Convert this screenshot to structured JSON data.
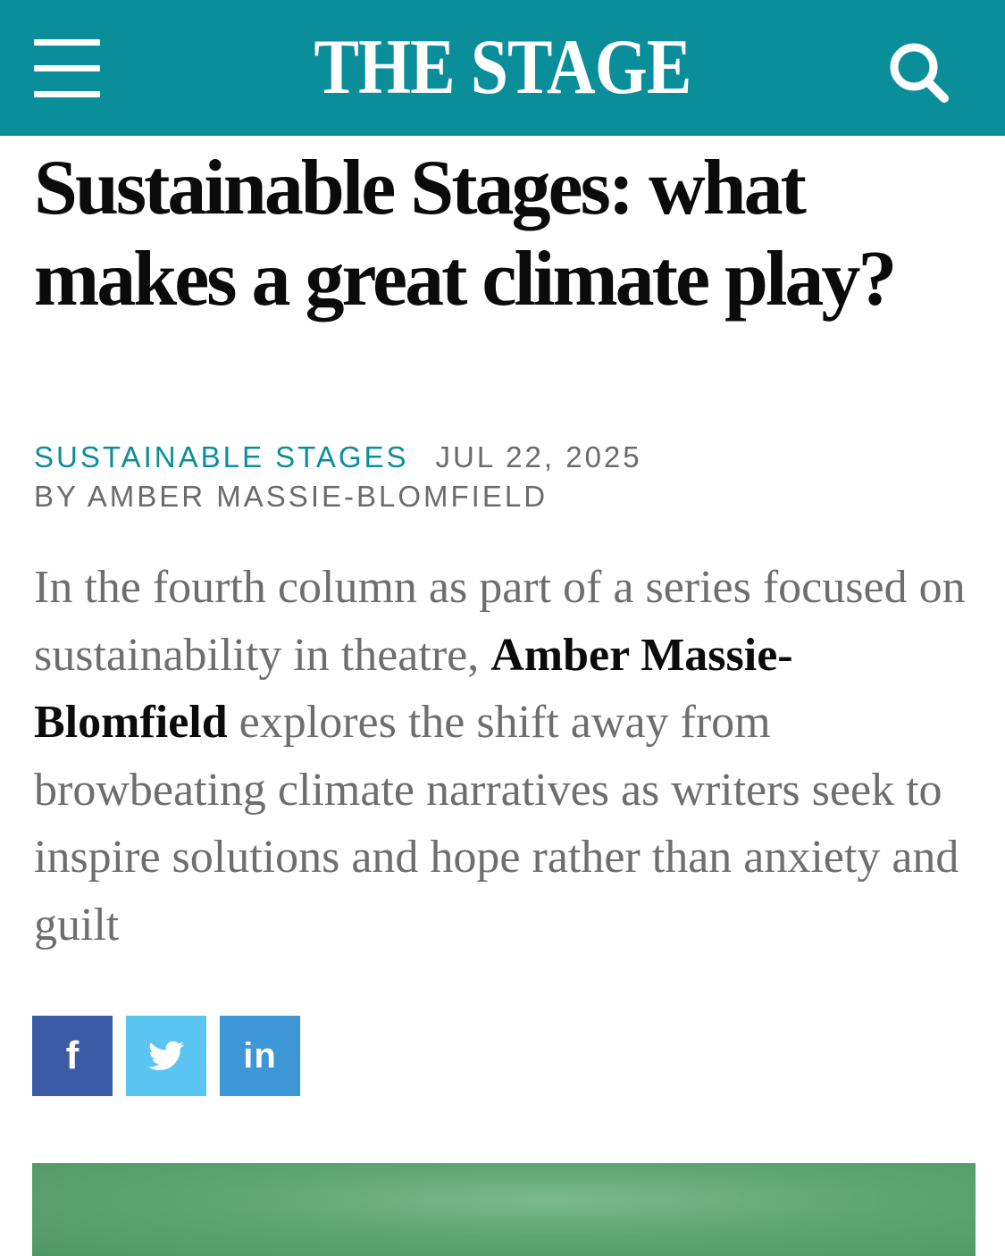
{
  "header": {
    "logo": "THE STAGE",
    "menu_icon": "hamburger-menu-icon",
    "search_icon": "search-icon",
    "background_color": "#0a8f9a"
  },
  "article": {
    "headline": "Sustainable Stages: what makes a great climate play?",
    "category": "SUSTAINABLE STAGES",
    "date": "JUL 22, 2025",
    "byline": "BY AMBER MASSIE-BLOMFIELD",
    "standfirst": {
      "before_author": "In the fourth column as part of a series focused on sustainability in theatre, ",
      "author": "Amber Massie-Blomfield",
      "after_author": " explores the shift away from browbeating climate narratives as writers seek to inspire solutions and hope rather than anxiety and guilt"
    }
  },
  "share": {
    "facebook": {
      "label": "f",
      "icon": "facebook-icon",
      "color": "#3b5ba7"
    },
    "twitter": {
      "icon": "twitter-bird-icon",
      "color": "#5bc5f2"
    },
    "linkedin": {
      "label": "in",
      "icon": "linkedin-icon",
      "color": "#3d96d6"
    }
  },
  "colors": {
    "accent": "#0a8f9a",
    "headline": "#0b0b0b",
    "meta_grey": "#6b6b6b",
    "body_grey": "#6e6e6e"
  }
}
